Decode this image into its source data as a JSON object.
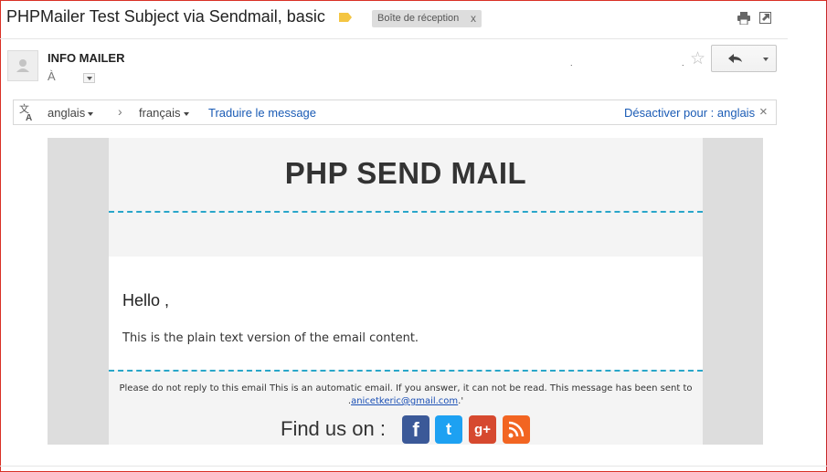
{
  "header": {
    "subject": "PHPMailer Test Subject via Sendmail, basic",
    "label_chip": "Boîte de réception",
    "chip_close": "x"
  },
  "message": {
    "sender": "INFO MAILER",
    "to_label": "À",
    "meta_dot_1": ".",
    "meta_dot_2": "."
  },
  "translation": {
    "source_lang": "anglais",
    "arrow": "›",
    "target_lang": "français",
    "translate_link": "Traduire le message",
    "disable_link": "Désactiver pour : anglais",
    "close": "×"
  },
  "email": {
    "title": "PHP SEND MAIL",
    "greeting": "Hello ,",
    "body": "This is the plain text version of the email content.",
    "footer_text": "Please do not reply to this email This is an automatic email. If you answer, it can not be read. This message has been sent to .",
    "footer_email": "anicetkeric@gmail.com",
    "footer_end": ".'",
    "find_us": "Find us on :",
    "social": {
      "facebook": "f",
      "twitter": "t",
      "googleplus": "g+",
      "rss": ""
    }
  },
  "colors": {
    "accent_dash": "#29a6c9",
    "link": "#1a5bb5",
    "facebook": "#3b5998",
    "twitter": "#1da1f2",
    "googleplus": "#d6492f",
    "rss": "#f26522"
  },
  "icons": [
    "tag-icon",
    "print-icon",
    "new-window-icon",
    "avatar-icon",
    "star-icon",
    "reply-icon",
    "translate-icon",
    "close-icon",
    "facebook-icon",
    "twitter-icon",
    "google-plus-icon",
    "rss-icon"
  ]
}
